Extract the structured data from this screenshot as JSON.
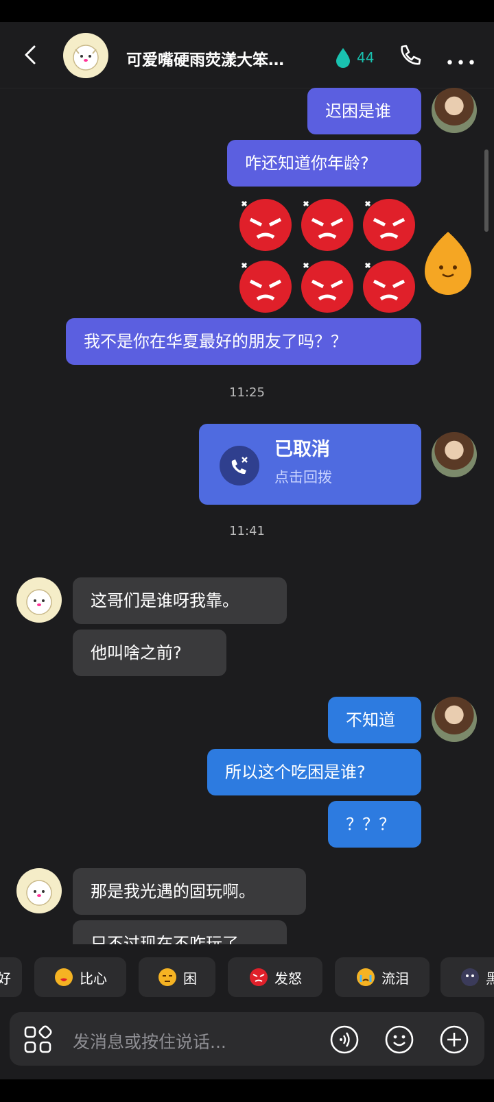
{
  "header": {
    "title": "可爱嘴硬雨荧漾大笨…",
    "spark_count": "44"
  },
  "messages": [
    {
      "side": "out",
      "text": "迟困是谁"
    },
    {
      "side": "out",
      "text": "咋还知道你年龄?"
    },
    {
      "side": "out",
      "text": "我不是你在华夏最好的朋友了吗？？"
    },
    {
      "side": "out",
      "text": "不知道"
    },
    {
      "side": "out",
      "text": "所以这个吃困是谁?"
    },
    {
      "side": "out",
      "text": "？？？"
    },
    {
      "side": "in",
      "text": "这哥们是谁呀我靠。"
    },
    {
      "side": "in",
      "text": "他叫啥之前?"
    },
    {
      "side": "in",
      "text": "那是我光遇的固玩啊。"
    },
    {
      "side": "in",
      "text": "只不过现在不咋玩了"
    }
  ],
  "timestamps": [
    "11:25",
    "11:41"
  ],
  "call": {
    "title": "已取消",
    "subtitle": "点击回拨"
  },
  "quick_replies": [
    {
      "label": "好",
      "icon": "thumbs-up-icon"
    },
    {
      "label": "比心",
      "icon": "heart-hands-icon"
    },
    {
      "label": "困",
      "icon": "sleepy-face-icon"
    },
    {
      "label": "发怒",
      "icon": "angry-face-icon"
    },
    {
      "label": "流泪",
      "icon": "crying-face-icon"
    },
    {
      "label": "黑",
      "icon": "dark-face-icon"
    }
  ],
  "input": {
    "placeholder": "发消息或按住说话..."
  },
  "colors": {
    "background": "#1c1c1e",
    "bubble_out_purple": "#5b5fe0",
    "bubble_out_blue": "#2d7be0",
    "bubble_in": "#3a3a3c",
    "spark": "#19c2b0"
  }
}
